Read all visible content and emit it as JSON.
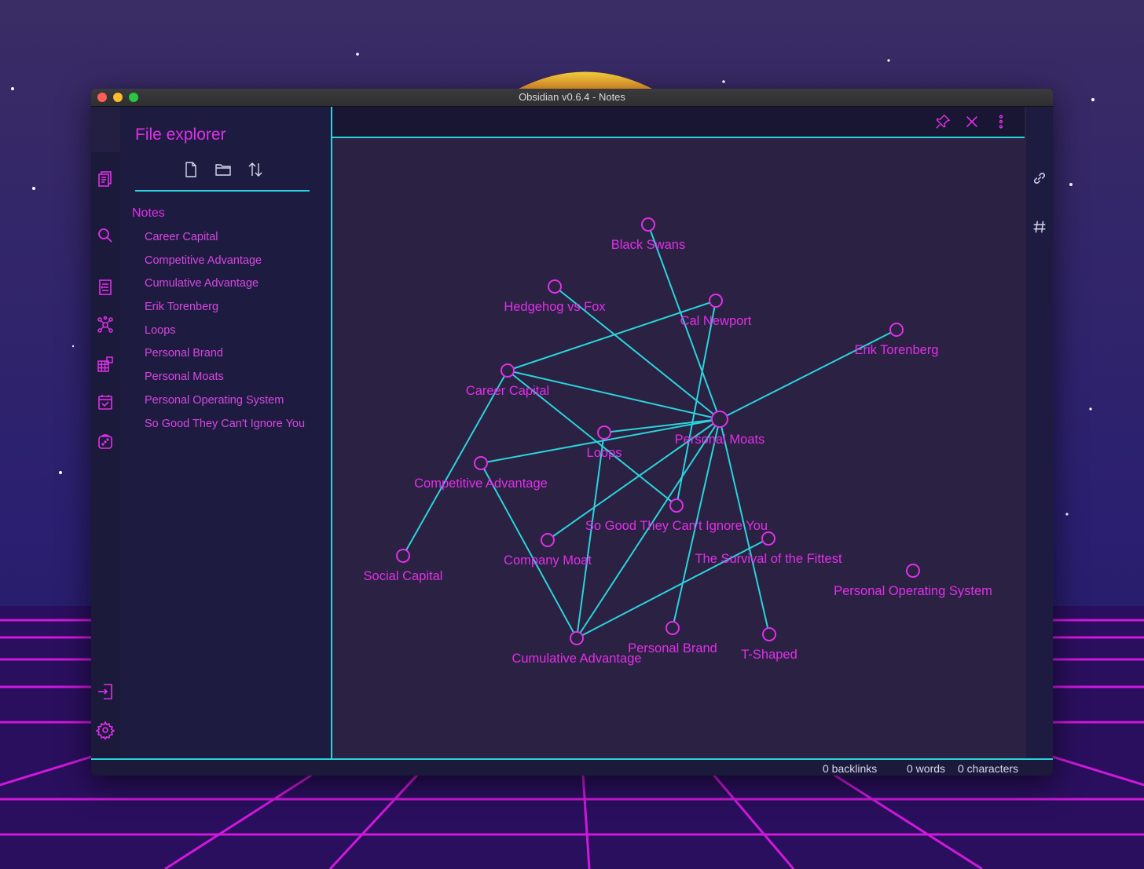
{
  "window": {
    "title": "Obsidian v0.6.4 - Notes"
  },
  "sidebar": {
    "title": "File explorer",
    "folder": "Notes",
    "notes": [
      "Career Capital",
      "Competitive Advantage",
      "Cumulative Advantage",
      "Erik Torenberg",
      "Loops",
      "Personal Brand",
      "Personal Moats",
      "Personal Operating System",
      "So Good They Can't Ignore You"
    ]
  },
  "graph": {
    "nodes": [
      {
        "id": "personal-moats",
        "label": "Personal Moats",
        "hub": true
      },
      {
        "id": "black-swans",
        "label": "Black Swans"
      },
      {
        "id": "hedgehog-vs-fox",
        "label": "Hedgehog vs Fox"
      },
      {
        "id": "cal-newport",
        "label": "Cal Newport"
      },
      {
        "id": "erik-torenberg",
        "label": "Erik Torenberg"
      },
      {
        "id": "career-capital",
        "label": "Career Capital"
      },
      {
        "id": "loops",
        "label": "Loops"
      },
      {
        "id": "competitive-advantage",
        "label": "Competitive Advantage"
      },
      {
        "id": "so-good",
        "label": "So Good They Can't Ignore You"
      },
      {
        "id": "company-moat",
        "label": "Company Moat"
      },
      {
        "id": "survival-fittest",
        "label": "The Survival of the Fittest"
      },
      {
        "id": "social-capital",
        "label": "Social Capital"
      },
      {
        "id": "personal-operating-system",
        "label": "Personal Operating System"
      },
      {
        "id": "cumulative-advantage",
        "label": "Cumulative Advantage"
      },
      {
        "id": "personal-brand",
        "label": "Personal Brand"
      },
      {
        "id": "t-shaped",
        "label": "T-Shaped"
      }
    ],
    "edges": [
      [
        "personal-moats",
        "black-swans"
      ],
      [
        "personal-moats",
        "hedgehog-vs-fox"
      ],
      [
        "personal-moats",
        "erik-torenberg"
      ],
      [
        "personal-moats",
        "career-capital"
      ],
      [
        "personal-moats",
        "loops"
      ],
      [
        "personal-moats",
        "competitive-advantage"
      ],
      [
        "personal-moats",
        "company-moat"
      ],
      [
        "personal-moats",
        "cumulative-advantage"
      ],
      [
        "personal-moats",
        "personal-brand"
      ],
      [
        "personal-moats",
        "t-shaped"
      ],
      [
        "career-capital",
        "cal-newport"
      ],
      [
        "career-capital",
        "so-good"
      ],
      [
        "career-capital",
        "social-capital"
      ],
      [
        "cal-newport",
        "so-good"
      ],
      [
        "loops",
        "cumulative-advantage"
      ],
      [
        "competitive-advantage",
        "cumulative-advantage"
      ],
      [
        "cumulative-advantage",
        "survival-fittest"
      ]
    ]
  },
  "status": {
    "backlinks": "0 backlinks",
    "words": "0 words",
    "characters": "0 characters"
  },
  "icons": {
    "ribbon_top": [
      "files-icon"
    ],
    "ribbon": [
      "search-icon",
      "quick-switcher-icon",
      "graph-icon",
      "kanban-icon",
      "daily-note-icon",
      "random-note-icon"
    ],
    "ribbon_bottom": [
      "open-vault-icon",
      "settings-icon"
    ],
    "sidebar_tools": [
      "new-note-icon",
      "new-folder-icon",
      "sort-icon"
    ],
    "header": [
      "pin-icon",
      "close-icon",
      "more-options-icon"
    ],
    "right_strip": [
      "link-icon",
      "hashtag-icon"
    ]
  },
  "colors": {
    "accent_cyan": "#2ad4dc",
    "accent_magenta": "#e030e8",
    "graph_background": "#2b2142",
    "sidebar_background": "#1d1c40"
  }
}
